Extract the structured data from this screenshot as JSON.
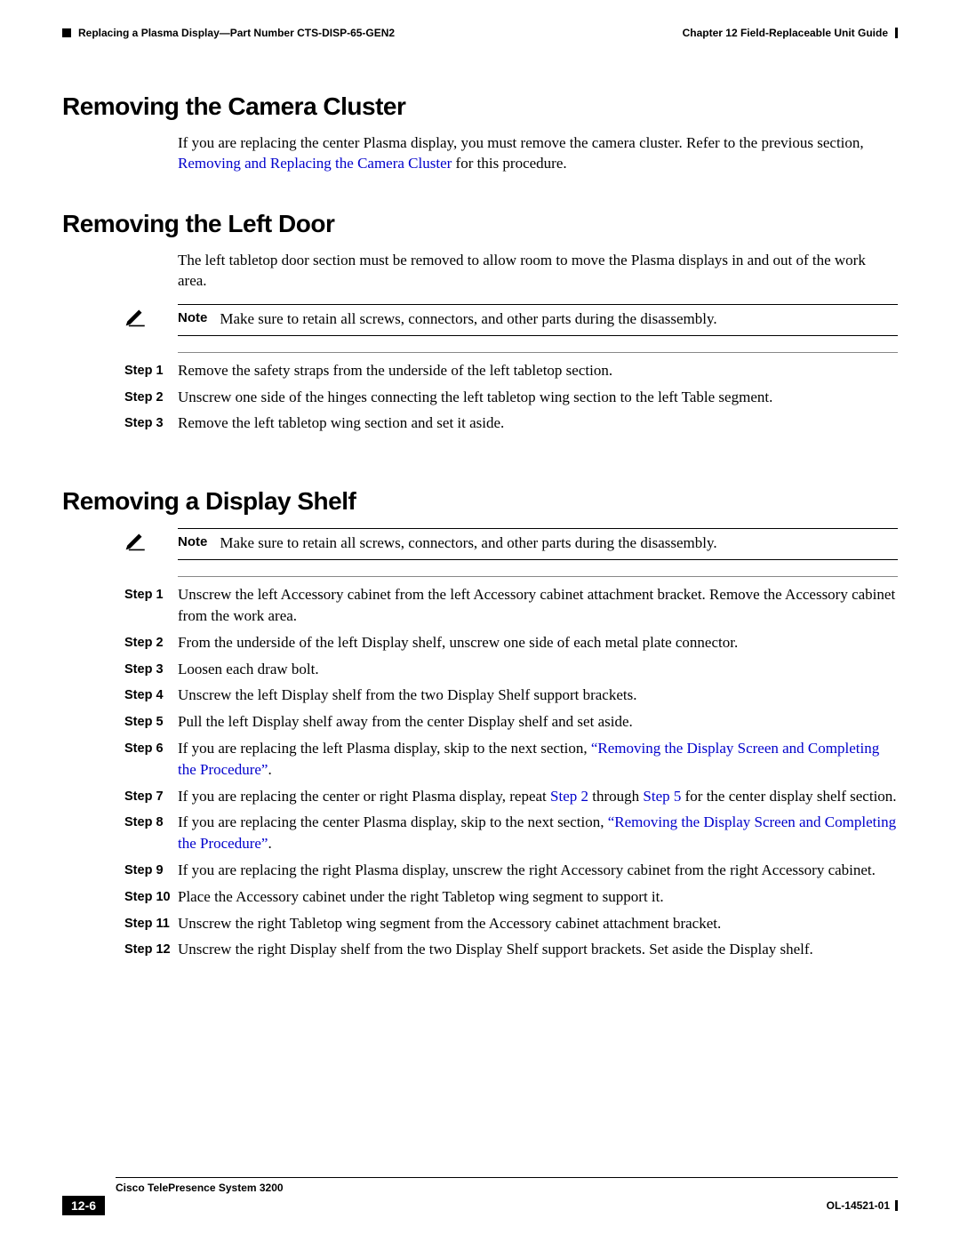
{
  "header": {
    "chapter": "Chapter 12    Field-Replaceable Unit Guide",
    "section": "Replacing a Plasma Display—Part Number CTS-DISP-65-GEN2"
  },
  "s1": {
    "title": "Removing the Camera Cluster",
    "p1a": "If you are replacing the center Plasma display, you must remove the camera cluster. Refer to the previous section, ",
    "p1link": "Removing and Replacing the Camera Cluster",
    "p1b": " for this procedure."
  },
  "s2": {
    "title": "Removing the Left Door",
    "p1": "The left tabletop door section must be removed to allow room to move the Plasma displays in and out of the work area.",
    "note_label": "Note",
    "note_text": "Make sure to retain all screws, connectors, and other parts during the disassembly.",
    "steps": [
      {
        "label": "Step 1",
        "text": "Remove the safety straps from the underside of the left tabletop section."
      },
      {
        "label": "Step 2",
        "text": "Unscrew one side of the hinges connecting the left tabletop wing section to the left Table segment."
      },
      {
        "label": "Step 3",
        "text": "Remove the left tabletop wing section and set it aside."
      }
    ]
  },
  "s3": {
    "title": "Removing a Display Shelf",
    "note_label": "Note",
    "note_text": "Make sure to retain all screws, connectors, and other parts during the disassembly.",
    "steps": {
      "1": {
        "label": "Step 1",
        "text": "Unscrew the left Accessory cabinet from the left Accessory cabinet attachment bracket. Remove the Accessory cabinet from the work area."
      },
      "2": {
        "label": "Step 2",
        "text": "From the underside of the left Display shelf, unscrew one side of each metal plate connector."
      },
      "3": {
        "label": "Step 3",
        "text": "Loosen each draw bolt."
      },
      "4": {
        "label": "Step 4",
        "text": "Unscrew the left Display shelf from the two Display Shelf support brackets."
      },
      "5": {
        "label": "Step 5",
        "text": "Pull the left Display shelf away from the center Display shelf and set aside."
      },
      "6": {
        "label": "Step 6",
        "a": "If you are replacing the left Plasma display, skip to the next section, ",
        "link": "“Removing the Display Screen and Completing the Procedure”",
        "b": "."
      },
      "7": {
        "label": "Step 7",
        "a": "If you are replacing the center or right Plasma display, repeat ",
        "link1": "Step 2",
        "mid": " through ",
        "link2": "Step 5",
        "b": " for the center display shelf section."
      },
      "8": {
        "label": "Step 8",
        "a": "If you are replacing the center Plasma display, skip to the next section, ",
        "link": "“Removing the Display Screen and Completing the Procedure”",
        "b": "."
      },
      "9": {
        "label": "Step 9",
        "text": "If you are replacing the right Plasma display, unscrew the right Accessory cabinet from the right Accessory cabinet."
      },
      "10": {
        "label": "Step 10",
        "text": "Place the Accessory cabinet under the right Tabletop wing segment to support it."
      },
      "11": {
        "label": "Step 11",
        "text": "Unscrew the right Tabletop wing segment from the Accessory cabinet attachment bracket."
      },
      "12": {
        "label": "Step 12",
        "text": "Unscrew the right Display shelf from the two Display Shelf support brackets. Set aside the Display shelf."
      }
    }
  },
  "footer": {
    "book": "Cisco TelePresence System 3200",
    "page": "12-6",
    "docid": "OL-14521-01"
  }
}
